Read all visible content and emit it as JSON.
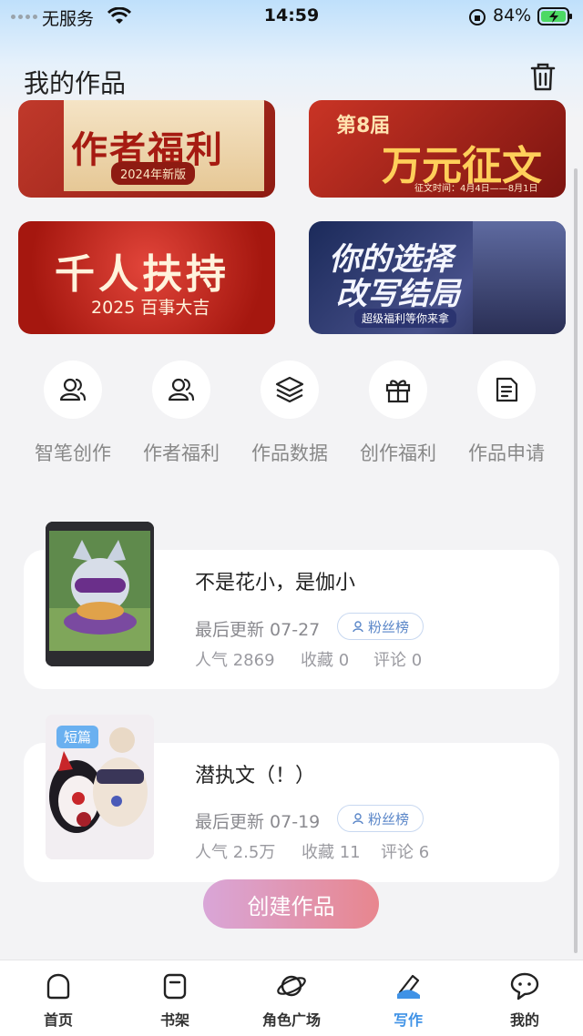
{
  "status_bar": {
    "carrier": "无服务",
    "time": "14:59",
    "battery": "84%"
  },
  "header": {
    "title": "我的作品"
  },
  "banners": [
    {
      "line1": "作者福利",
      "line2": "2024年新版"
    },
    {
      "line1": "第8届",
      "line2": "万元征文",
      "line3": "征文时间：4月4日——8月1日"
    },
    {
      "line1": "千人扶持",
      "line2": "2025 百事大吉"
    },
    {
      "line1": "你的选择",
      "line2": "改写结局",
      "line3": "超级福利等你来拿"
    }
  ],
  "quick_actions": [
    {
      "label": "智笔创作",
      "icon": "users-icon"
    },
    {
      "label": "作者福利",
      "icon": "users-icon"
    },
    {
      "label": "作品数据",
      "icon": "layers-icon"
    },
    {
      "label": "创作福利",
      "icon": "gift-icon"
    },
    {
      "label": "作品申请",
      "icon": "document-icon"
    }
  ],
  "works": [
    {
      "title": "不是花小，是伽小",
      "updated": "最后更新 07-27",
      "badge": "粉丝榜",
      "popularity": "人气 2869",
      "favorites": "收藏 0",
      "comments": "评论 0"
    },
    {
      "tag": "短篇",
      "title": "潜执文（！）",
      "updated": "最后更新 07-19",
      "badge": "粉丝榜",
      "popularity": "人气 2.5万",
      "favorites": "收藏 11",
      "comments": "评论 6"
    }
  ],
  "create_button": "创建作品",
  "tabbar": [
    {
      "label": "首页",
      "icon": "home-icon"
    },
    {
      "label": "书架",
      "icon": "bookshelf-icon"
    },
    {
      "label": "角色广场",
      "icon": "planet-icon"
    },
    {
      "label": "写作",
      "icon": "pen-icon",
      "active": true
    },
    {
      "label": "我的",
      "icon": "chat-icon"
    }
  ],
  "colors": {
    "accent": "#3f92e6",
    "badge": "#5a86c8",
    "create_gradient_start": "#d9a6d8",
    "create_gradient_end": "#e8868e"
  }
}
